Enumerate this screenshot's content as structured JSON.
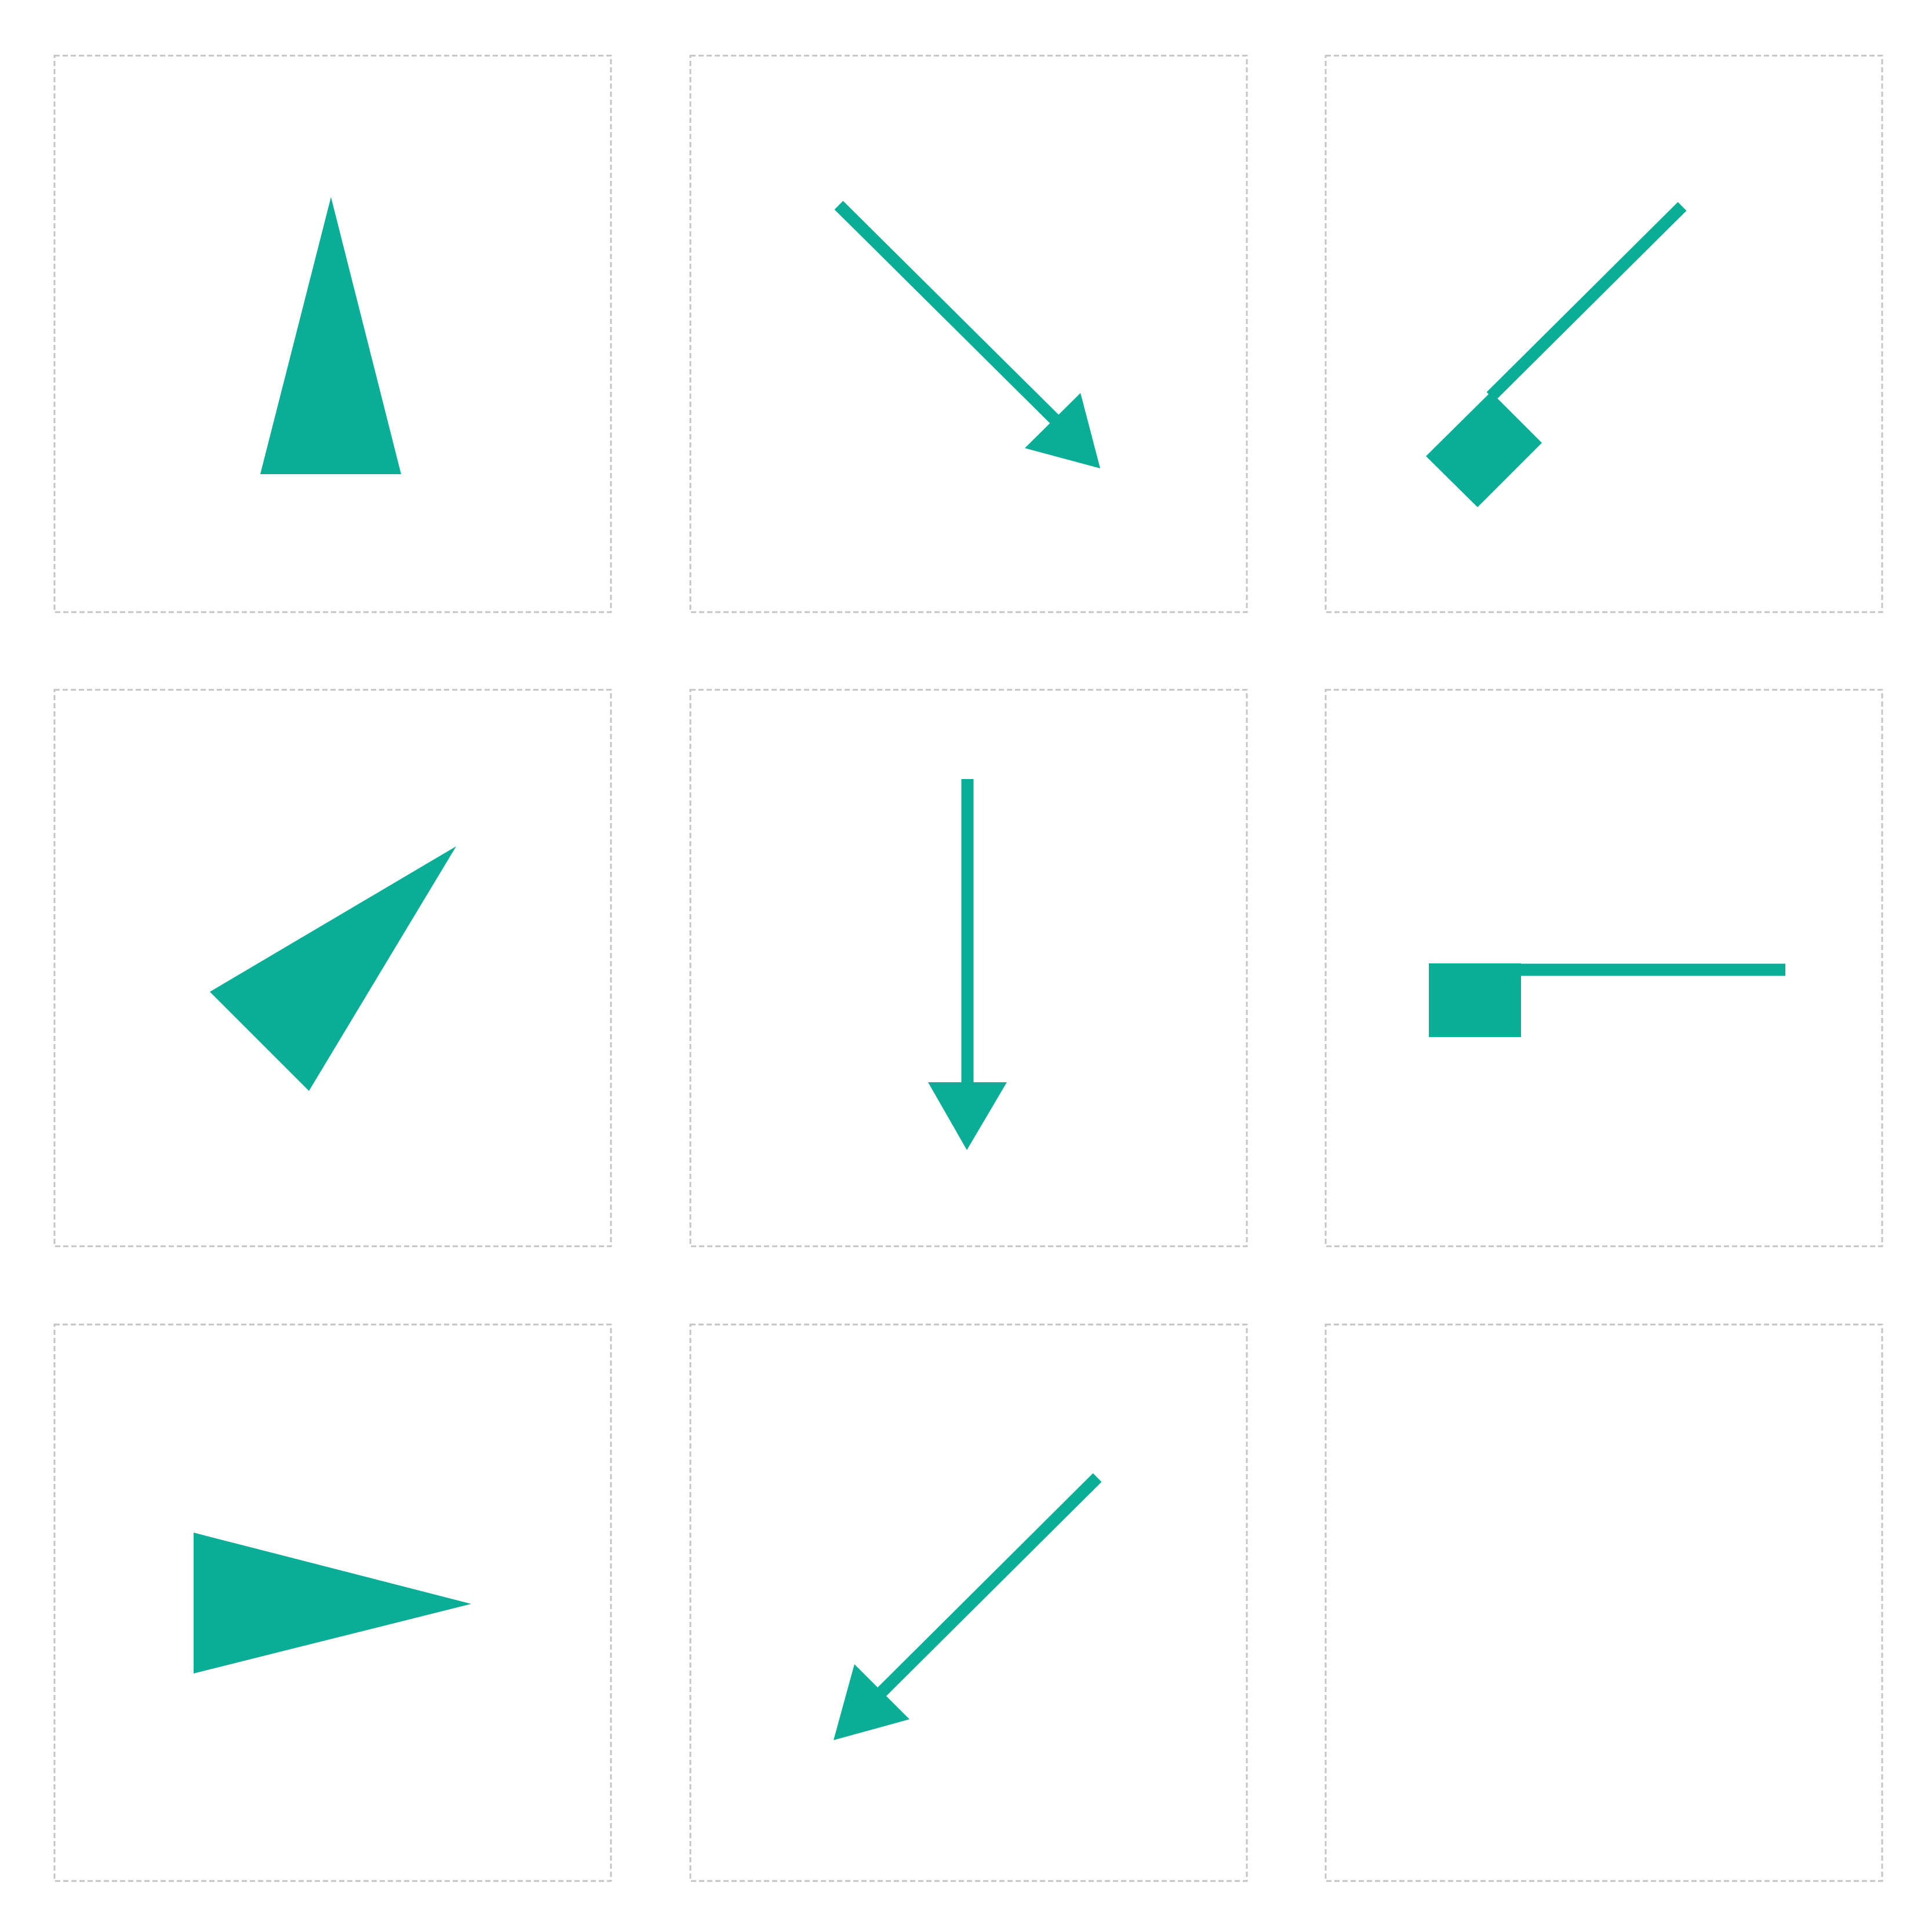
{
  "colors": {
    "shape": "#0aae96",
    "cell_border": "#c4c4c4",
    "background": "#ffffff"
  },
  "grid": {
    "rows": 3,
    "columns": 3
  },
  "cells": [
    {
      "id": "cell-1",
      "shape": "tall-triangle-up",
      "empty": false
    },
    {
      "id": "cell-2",
      "shape": "arrow-diagonal-down-right",
      "empty": false
    },
    {
      "id": "cell-3",
      "shape": "line-with-square-end-down-left",
      "empty": false
    },
    {
      "id": "cell-4",
      "shape": "wedge-triangle-pointing-up-right",
      "empty": false
    },
    {
      "id": "cell-5",
      "shape": "arrow-down",
      "empty": false
    },
    {
      "id": "cell-6",
      "shape": "line-with-square-end-left",
      "empty": false
    },
    {
      "id": "cell-7",
      "shape": "triangle-pointing-right",
      "empty": false
    },
    {
      "id": "cell-8",
      "shape": "arrow-diagonal-down-left",
      "empty": false
    },
    {
      "id": "cell-9",
      "shape": "empty",
      "empty": true
    }
  ]
}
